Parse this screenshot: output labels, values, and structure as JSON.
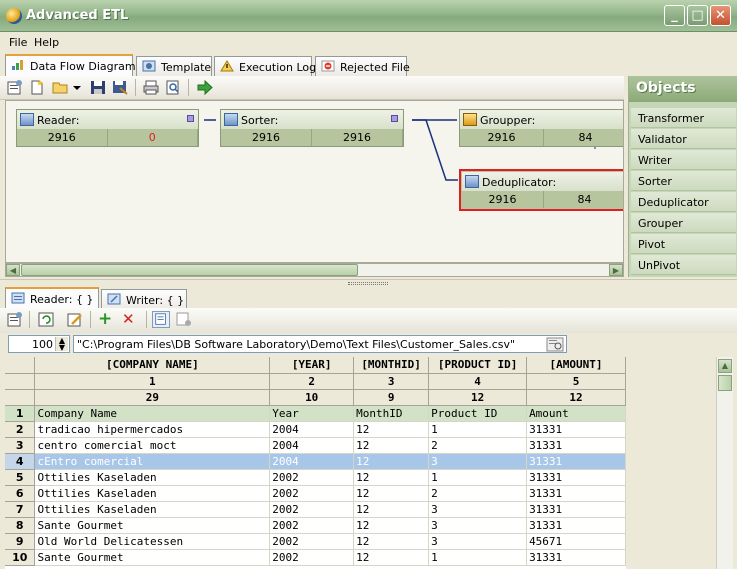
{
  "window": {
    "title": "Advanced ETL"
  },
  "menu": [
    "File",
    "Help"
  ],
  "top_tabs": [
    "Data Flow Diagram:",
    "Template",
    "Execution Log",
    "Rejected File"
  ],
  "objects_panel": {
    "title": "Objects",
    "items": [
      "Transformer",
      "Validator",
      "Writer",
      "Sorter",
      "Deduplicator",
      "Grouper",
      "Pivot",
      "UnPivot"
    ]
  },
  "nodes": {
    "reader": {
      "label": "Reader:",
      "in": "2916",
      "out": "0"
    },
    "sorter": {
      "label": "Sorter:",
      "in": "2916",
      "out": "2916"
    },
    "groupper": {
      "label": "Groupper:",
      "in": "2916",
      "out": "84"
    },
    "deduplicator": {
      "label": "Deduplicator:",
      "in": "2916",
      "out": "84"
    }
  },
  "bottom_tabs": [
    "Reader: { }",
    "Writer: { }"
  ],
  "spin_value": "100",
  "file_path": "\"C:\\Program Files\\DB Software Laboratory\\Demo\\Text Files\\Customer_Sales.csv\"",
  "grid": {
    "columns": [
      "[COMPANY NAME]",
      "[YEAR]",
      "[MONTHID]",
      "[PRODUCT ID]",
      "[AMOUNT]"
    ],
    "column_index": [
      "1",
      "2",
      "3",
      "4",
      "5"
    ],
    "column_width": [
      "29",
      "10",
      "9",
      "12",
      "12"
    ],
    "rows": [
      {
        "n": "1",
        "cells": [
          "Company Name",
          "Year",
          "MonthID",
          "Product ID",
          "Amount"
        ]
      },
      {
        "n": "2",
        "cells": [
          "tradicao         hipermercados",
          "2004",
          "12",
          "1",
          "31331"
        ]
      },
      {
        "n": "3",
        "cells": [
          "centro       comercial     moct",
          "2004",
          "12",
          "2",
          "31331"
        ]
      },
      {
        "n": "4",
        "cells": [
          "cEntro       comercial",
          "2004",
          "12",
          "3",
          "31331"
        ]
      },
      {
        "n": "5",
        "cells": [
          "Ottilies Kaseladen",
          "2002",
          "12",
          "1",
          "31331"
        ]
      },
      {
        "n": "6",
        "cells": [
          "Ottilies Kaseladen",
          "2002",
          "12",
          "2",
          "31331"
        ]
      },
      {
        "n": "7",
        "cells": [
          "Ottilies Kaseladen",
          "2002",
          "12",
          "3",
          "31331"
        ]
      },
      {
        "n": "8",
        "cells": [
          "Sante Gourmet",
          "2002",
          "12",
          "3",
          "31331"
        ]
      },
      {
        "n": "9",
        "cells": [
          "Old World Delicatessen",
          "2002",
          "12",
          "3",
          "45671"
        ]
      },
      {
        "n": "10",
        "cells": [
          "Sante Gourmet",
          "2002",
          "12",
          "1",
          "31331"
        ]
      }
    ]
  }
}
